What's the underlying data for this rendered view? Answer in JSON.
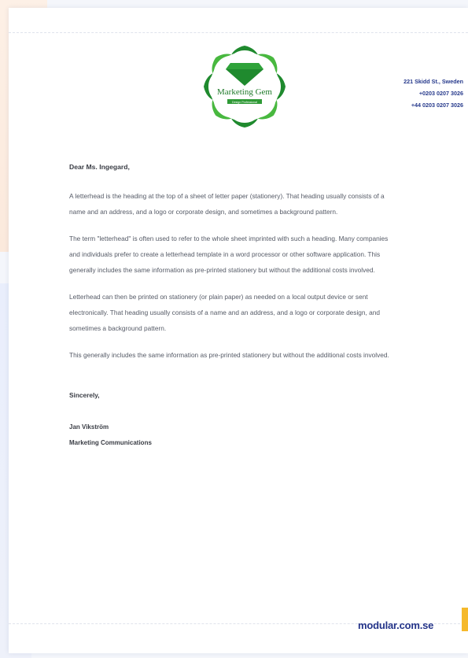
{
  "logo": {
    "name": "Marketing Gem",
    "tagline": "Design Professional",
    "colors": {
      "green": "#1f8a2e",
      "light_green": "#48b83f"
    }
  },
  "contact": {
    "address": "221 Skidd St., Sweden",
    "phone_1": "+0203 0207 3026",
    "phone_2": "+44 0203 0207 3026"
  },
  "letter": {
    "salutation": "Dear Ms. Ingegard,",
    "paragraphs": [
      "A letterhead is the heading at the top of a sheet of letter paper (stationery). That heading usually consists of a name and an address, and a logo or corporate design, and sometimes a background pattern.",
      "The term \"letterhead\" is often used to refer to the whole sheet imprinted with such a heading. Many companies and individuals prefer to create a letterhead template in a word processor or other software application. This generally includes the same information as pre-printed stationery but without the additional costs involved.",
      "Letterhead can then be printed on stationery (or plain paper) as needed on a local output device or sent electronically. That heading usually consists of a name and an address, and a logo or corporate design, and sometimes a background pattern.",
      "This generally includes the same information as pre-printed stationery but without the additional costs involved."
    ],
    "closing": "Sincerely,",
    "signer_name": "Jan Vikström",
    "signer_title": "Marketing Communications"
  },
  "footer": {
    "brand": "modular.com.se",
    "brand_color": "#243489",
    "accent_color": "#f5b92c"
  }
}
